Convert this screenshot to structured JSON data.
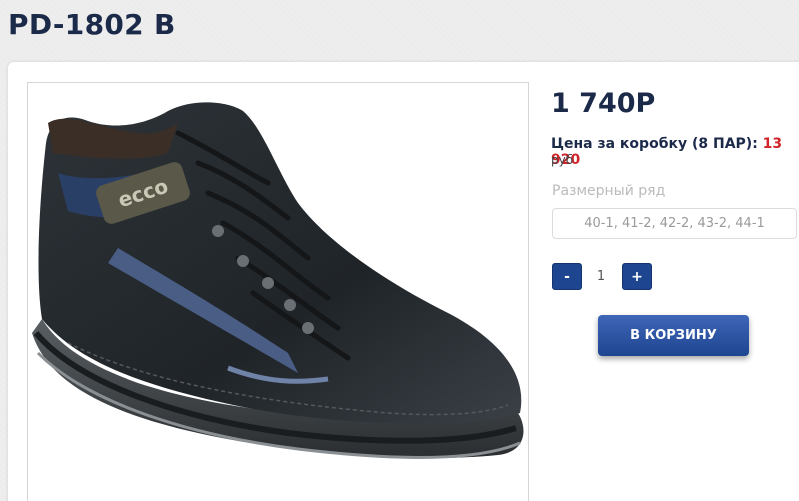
{
  "product": {
    "title": "PD-1802 B",
    "price": "1 740Р",
    "box_price_label": "Цена за коробку (8 ПАР):",
    "box_price_value": "13 920",
    "currency": "руб",
    "sizes_label": "Размерный ряд",
    "sizes_value": "40-1, 41-2, 42-2, 43-2, 44-1",
    "image_alt": "black leather ecco boot",
    "logo_text": "ecco"
  },
  "quantity": {
    "minus": "-",
    "value": "1",
    "plus": "+"
  },
  "cart": {
    "button_label": "В КОРЗИНУ"
  },
  "colors": {
    "accent": "#1e4590",
    "title": "#1c2a4a",
    "price_highlight": "#d0242b"
  }
}
